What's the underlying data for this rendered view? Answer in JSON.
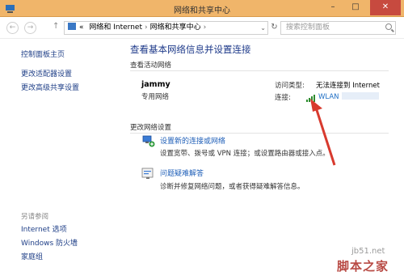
{
  "window": {
    "title": "网络和共享中心",
    "minimize": "–",
    "maximize": "□",
    "close": "✕"
  },
  "nav": {
    "back": "←",
    "forward": "→",
    "up": "↑",
    "chevrons": "«",
    "breadcrumb": [
      "网络和 Internet",
      "网络和共享中心"
    ],
    "separator": "›",
    "dropdown": "⌄",
    "refresh": "↻",
    "search_placeholder": "搜索控制面板"
  },
  "sidebar": {
    "items": [
      {
        "label": "控制面板主页"
      },
      {
        "label": "更改适配器设置"
      },
      {
        "label": "更改高级共享设置"
      }
    ],
    "see_also_heading": "另请参阅",
    "see_also": [
      {
        "label": "Internet 选项"
      },
      {
        "label": "Windows 防火墙"
      },
      {
        "label": "家庭组"
      }
    ]
  },
  "main": {
    "title": "查看基本网络信息并设置连接",
    "active_networks_heading": "查看活动网络",
    "network_name": "jammy",
    "network_type": "专用网络",
    "access_type_label": "访问类型:",
    "access_type_value": "无法连接到 Internet",
    "connections_label": "连接:",
    "connection_name": "WLAN",
    "change_settings_heading": "更改网络设置",
    "tasks": [
      {
        "link": "设置新的连接或网络",
        "desc": "设置宽带、拨号或 VPN 连接；或设置路由器或接入点。"
      },
      {
        "link": "问题疑难解答",
        "desc": "诊断并修复网络问题，或者获得疑难解答信息。"
      }
    ]
  },
  "watermark": {
    "line1": "jb51.net",
    "line2": "脚本之家"
  },
  "colors": {
    "titlebar": "#f0b56a",
    "link": "#1f3f87",
    "arrow": "#d83a2e"
  }
}
